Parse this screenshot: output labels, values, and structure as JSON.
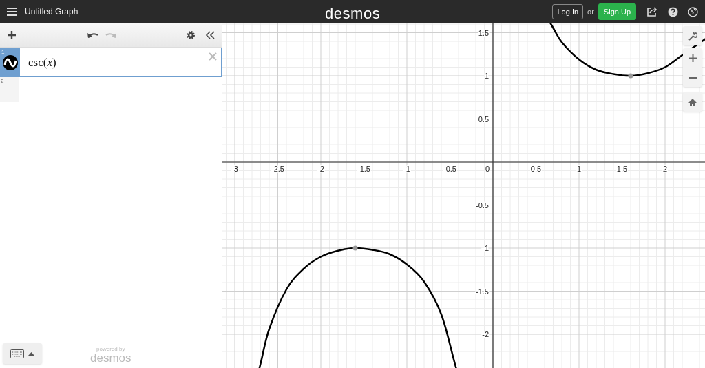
{
  "header": {
    "title": "Untitled Graph",
    "logo": "desmos",
    "login": "Log In",
    "or": "or",
    "signup": "Sign Up"
  },
  "expressions": [
    {
      "index": "1",
      "latex": "csc(*x*)",
      "selected": true,
      "visible": true
    },
    {
      "index": "2",
      "selected": false,
      "visible": false
    }
  ],
  "footer": {
    "powered_by": "powered by",
    "brand": "desmos"
  },
  "graph": {
    "origin_label": "0",
    "chart_data": {
      "type": "line",
      "xlim": [
        -3.144,
        2.464
      ],
      "ylim": [
        -2.392,
        1.608
      ],
      "xticks": [
        -3,
        -2.5,
        -2,
        -1.5,
        -1,
        -0.5,
        0.5,
        1,
        1.5,
        2
      ],
      "yticks": [
        -2,
        -1.5,
        -1,
        -0.5,
        0.5,
        1,
        1.5
      ],
      "x": [
        -2.7,
        -2.6,
        -2.4,
        -2.2,
        -2.0,
        -1.8,
        -1.6,
        -1.4,
        -1.2,
        -1.0,
        -0.8,
        -0.6,
        -0.44,
        0.68,
        0.8,
        1.0,
        1.2,
        1.4,
        1.6,
        1.8,
        2.0,
        2.2
      ],
      "series": [
        {
          "color": "#000000",
          "values": [
            -2.34,
            -1.94,
            -1.48,
            -1.24,
            -1.1,
            -1.03,
            -1.0,
            -1.02,
            -1.07,
            -1.19,
            -1.39,
            -1.77,
            -2.35,
            null,
            null,
            null,
            null,
            null,
            null,
            null,
            null,
            null
          ]
        },
        {
          "color": "#000000",
          "values": [
            null,
            null,
            null,
            null,
            null,
            null,
            null,
            null,
            null,
            null,
            null,
            null,
            null,
            1.59,
            1.39,
            1.19,
            1.07,
            1.02,
            1.0,
            1.03,
            1.1,
            1.24
          ]
        }
      ],
      "grid": true
    }
  }
}
